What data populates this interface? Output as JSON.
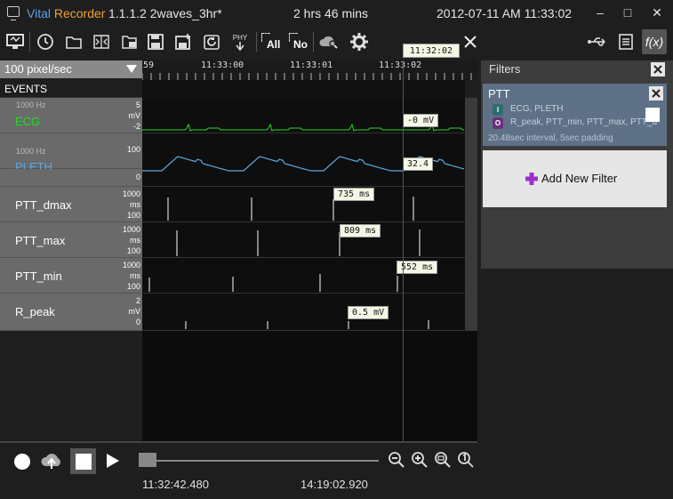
{
  "titlebar": {
    "brand_part1": "Vital",
    "brand_part2": "Recorder",
    "version": "1.1.1.2 2waves_3hr*",
    "duration": "2 hrs 46 mins",
    "datetime": "2012-07-11 AM 11:33:02",
    "minimize": "–",
    "maximize": "□",
    "close": "✕"
  },
  "toolbar": {
    "phy_label": "PHY",
    "all_label": "All",
    "no_label": "No",
    "fx_label": "f(x)"
  },
  "timeline": {
    "zoom_label": "100 pixel/sec",
    "cursor_time": "11:32:02",
    "tick_labels": [
      "59",
      "11:33:00",
      "11:33:01",
      "11:33:02"
    ]
  },
  "events_label": "EVENTS",
  "tracks": [
    {
      "hz": "1000 Hz",
      "name": "ECG",
      "color": "#22dd22",
      "scale": [
        "5",
        "mV",
        "-2"
      ],
      "value": "-0 mV"
    },
    {
      "hz": "1000 Hz",
      "name": "PLETH",
      "color": "#5aaae6",
      "scale": [
        "100",
        "",
        "0"
      ],
      "value": "32.4"
    },
    {
      "hz": "",
      "name": "PTT_dmax",
      "color": "#ffffff",
      "scale": [
        "1000",
        "ms",
        "100"
      ],
      "value": "735 ms"
    },
    {
      "hz": "",
      "name": "PTT_max",
      "color": "#ffffff",
      "scale": [
        "1000",
        "ms",
        "100"
      ],
      "value": "809 ms"
    },
    {
      "hz": "",
      "name": "PTT_min",
      "color": "#ffffff",
      "scale": [
        "1000",
        "ms",
        "100"
      ],
      "value": "552 ms"
    },
    {
      "hz": "",
      "name": "R_peak",
      "color": "#ffffff",
      "scale": [
        "2",
        "mV",
        "0"
      ],
      "value": "0.5 mV"
    }
  ],
  "playback": {
    "start_time": "11:32:42.480",
    "end_time": "14:19:02.920"
  },
  "filters": {
    "header": "Filters",
    "card": {
      "title": "PTT",
      "input_badge": "I",
      "input_text": "ECG, PLETH",
      "output_badge": "O",
      "output_text": "R_peak, PTT_min, PTT_max, PTT_d",
      "subtitle": "20.48sec interval, 5sec padding"
    },
    "add_label": "Add New Filter"
  },
  "colors": {
    "ecg": "#22dd22",
    "pleth": "#5aaae6",
    "accent_purple": "#9b30c8"
  }
}
